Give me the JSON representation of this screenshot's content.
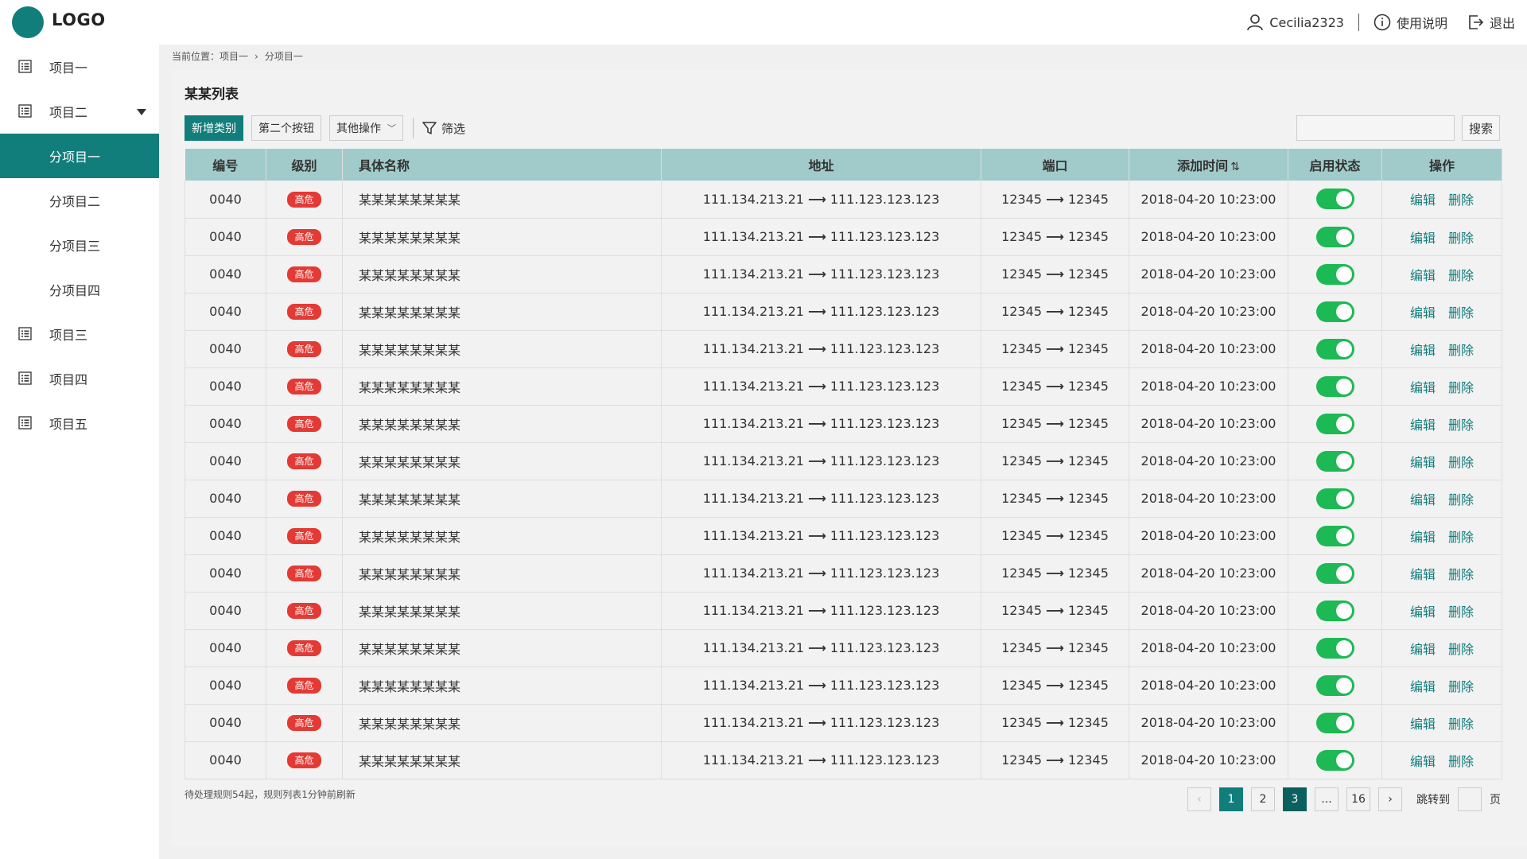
{
  "header": {
    "logo": "LOGO",
    "user": "Cecilia2323",
    "help": "使用说明",
    "logout": "退出"
  },
  "sidebar": {
    "items": [
      {
        "label": "项目一",
        "icon": "list-icon",
        "level": 1
      },
      {
        "label": "项目二",
        "icon": "list-icon",
        "level": 1,
        "expanded": true
      },
      {
        "label": "分项目一",
        "level": 2,
        "active": true
      },
      {
        "label": "分项目二",
        "level": 2
      },
      {
        "label": "分项目三",
        "level": 2
      },
      {
        "label": "分项目四",
        "level": 2
      },
      {
        "label": "项目三",
        "icon": "list-icon",
        "level": 1
      },
      {
        "label": "项目四",
        "icon": "list-icon",
        "level": 1
      },
      {
        "label": "项目五",
        "icon": "list-icon",
        "level": 1
      }
    ]
  },
  "breadcrumb": {
    "prefix": "当前位置：项目一",
    "current": "分项目一"
  },
  "main": {
    "title": "某某列表",
    "toolbar": {
      "add": "新增类别",
      "second": "第二个按钮",
      "other": "其他操作",
      "filter": "筛选",
      "search_placeholder": "",
      "search": "搜索"
    },
    "table": {
      "columns": [
        "编号",
        "级别",
        "具体名称",
        "地址",
        "端口",
        "添加时间",
        "启用状态",
        "操作"
      ],
      "rows": [
        {
          "id": "0040",
          "level": "高危",
          "name": "某某某某某某某某",
          "addr_from": "111.134.213.21",
          "addr_to": "111.123.123.123",
          "port_from": "12345",
          "port_to": "12345",
          "time": "2018-04-20 10:23:00",
          "enabled": true
        },
        {
          "id": "0040",
          "level": "高危",
          "name": "某某某某某某某某",
          "addr_from": "111.134.213.21",
          "addr_to": "111.123.123.123",
          "port_from": "12345",
          "port_to": "12345",
          "time": "2018-04-20 10:23:00",
          "enabled": true
        },
        {
          "id": "0040",
          "level": "高危",
          "name": "某某某某某某某某",
          "addr_from": "111.134.213.21",
          "addr_to": "111.123.123.123",
          "port_from": "12345",
          "port_to": "12345",
          "time": "2018-04-20 10:23:00",
          "enabled": true
        },
        {
          "id": "0040",
          "level": "高危",
          "name": "某某某某某某某某",
          "addr_from": "111.134.213.21",
          "addr_to": "111.123.123.123",
          "port_from": "12345",
          "port_to": "12345",
          "time": "2018-04-20 10:23:00",
          "enabled": true
        },
        {
          "id": "0040",
          "level": "高危",
          "name": "某某某某某某某某",
          "addr_from": "111.134.213.21",
          "addr_to": "111.123.123.123",
          "port_from": "12345",
          "port_to": "12345",
          "time": "2018-04-20 10:23:00",
          "enabled": true
        },
        {
          "id": "0040",
          "level": "高危",
          "name": "某某某某某某某某",
          "addr_from": "111.134.213.21",
          "addr_to": "111.123.123.123",
          "port_from": "12345",
          "port_to": "12345",
          "time": "2018-04-20 10:23:00",
          "enabled": true
        },
        {
          "id": "0040",
          "level": "高危",
          "name": "某某某某某某某某",
          "addr_from": "111.134.213.21",
          "addr_to": "111.123.123.123",
          "port_from": "12345",
          "port_to": "12345",
          "time": "2018-04-20 10:23:00",
          "enabled": true
        },
        {
          "id": "0040",
          "level": "高危",
          "name": "某某某某某某某某",
          "addr_from": "111.134.213.21",
          "addr_to": "111.123.123.123",
          "port_from": "12345",
          "port_to": "12345",
          "time": "2018-04-20 10:23:00",
          "enabled": true
        },
        {
          "id": "0040",
          "level": "高危",
          "name": "某某某某某某某某",
          "addr_from": "111.134.213.21",
          "addr_to": "111.123.123.123",
          "port_from": "12345",
          "port_to": "12345",
          "time": "2018-04-20 10:23:00",
          "enabled": true
        },
        {
          "id": "0040",
          "level": "高危",
          "name": "某某某某某某某某",
          "addr_from": "111.134.213.21",
          "addr_to": "111.123.123.123",
          "port_from": "12345",
          "port_to": "12345",
          "time": "2018-04-20 10:23:00",
          "enabled": true
        },
        {
          "id": "0040",
          "level": "高危",
          "name": "某某某某某某某某",
          "addr_from": "111.134.213.21",
          "addr_to": "111.123.123.123",
          "port_from": "12345",
          "port_to": "12345",
          "time": "2018-04-20 10:23:00",
          "enabled": true
        },
        {
          "id": "0040",
          "level": "高危",
          "name": "某某某某某某某某",
          "addr_from": "111.134.213.21",
          "addr_to": "111.123.123.123",
          "port_from": "12345",
          "port_to": "12345",
          "time": "2018-04-20 10:23:00",
          "enabled": true
        },
        {
          "id": "0040",
          "level": "高危",
          "name": "某某某某某某某某",
          "addr_from": "111.134.213.21",
          "addr_to": "111.123.123.123",
          "port_from": "12345",
          "port_to": "12345",
          "time": "2018-04-20 10:23:00",
          "enabled": true
        },
        {
          "id": "0040",
          "level": "高危",
          "name": "某某某某某某某某",
          "addr_from": "111.134.213.21",
          "addr_to": "111.123.123.123",
          "port_from": "12345",
          "port_to": "12345",
          "time": "2018-04-20 10:23:00",
          "enabled": true
        },
        {
          "id": "0040",
          "level": "高危",
          "name": "某某某某某某某某",
          "addr_from": "111.134.213.21",
          "addr_to": "111.123.123.123",
          "port_from": "12345",
          "port_to": "12345",
          "time": "2018-04-20 10:23:00",
          "enabled": true
        },
        {
          "id": "0040",
          "level": "高危",
          "name": "某某某某某某某某",
          "addr_from": "111.134.213.21",
          "addr_to": "111.123.123.123",
          "port_from": "12345",
          "port_to": "12345",
          "time": "2018-04-20 10:23:00",
          "enabled": true
        }
      ],
      "actions": {
        "edit": "编辑",
        "delete": "删除"
      }
    },
    "footer_note": "待处理规则54起，规则列表1分钟前刷新",
    "pagination": {
      "pages": [
        "1",
        "2",
        "3",
        "...",
        "16"
      ],
      "current": "3",
      "jump_label": "跳转到",
      "unit": "页"
    }
  },
  "colors": {
    "accent": "#117e7c",
    "header_row": "#a1cbca",
    "danger_badge": "#e33a35",
    "toggle_on": "#1db954"
  }
}
